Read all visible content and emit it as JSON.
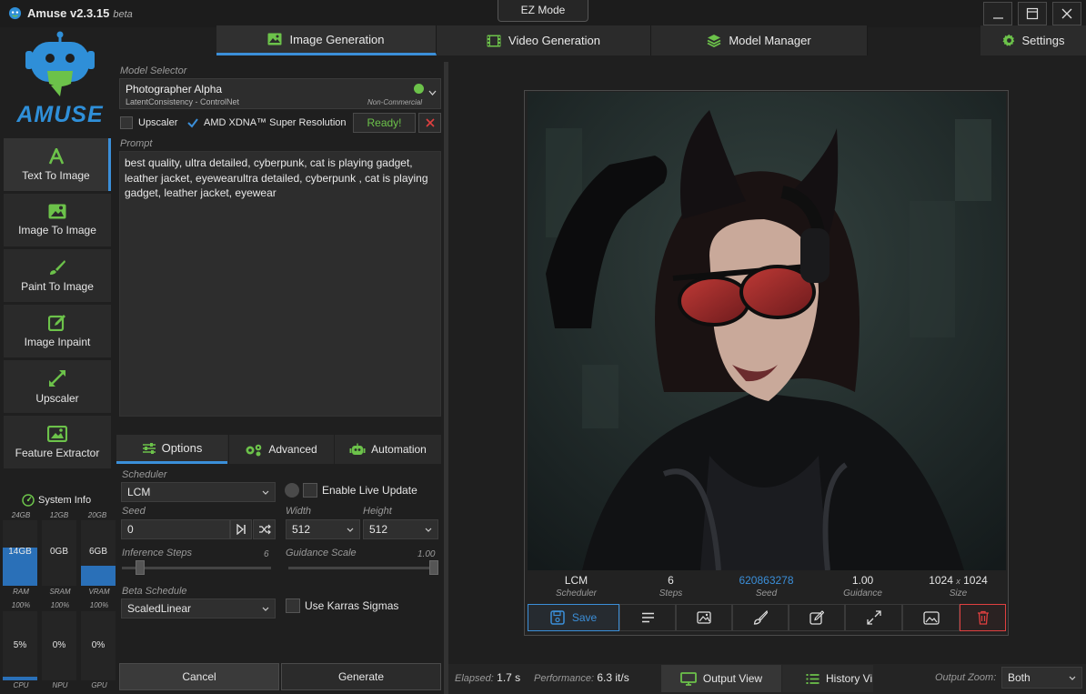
{
  "app": {
    "name": "Amuse v2.3.15",
    "beta": "beta",
    "ez_mode": "EZ Mode",
    "logo_text": "AMUSE"
  },
  "tabs": [
    {
      "label": "Image Generation",
      "icon": "image-icon"
    },
    {
      "label": "Video Generation",
      "icon": "film-icon"
    },
    {
      "label": "Model Manager",
      "icon": "layers-icon"
    }
  ],
  "settings_label": "Settings",
  "sidebar": {
    "items": [
      {
        "label": "Text To Image",
        "icon": "text-icon"
      },
      {
        "label": "Image To Image",
        "icon": "image-icon"
      },
      {
        "label": "Paint To Image",
        "icon": "brush-icon"
      },
      {
        "label": "Image Inpaint",
        "icon": "edit-icon"
      },
      {
        "label": "Upscaler",
        "icon": "expand-icon"
      },
      {
        "label": "Feature Extractor",
        "icon": "image-search-icon"
      }
    ]
  },
  "system_info": {
    "title": "System Info",
    "capacity": [
      "24GB",
      "12GB",
      "20GB"
    ],
    "memory": [
      {
        "value": "14GB",
        "label": "RAM",
        "fill": 0.58
      },
      {
        "value": "0GB",
        "label": "SRAM",
        "fill": 0.0
      },
      {
        "value": "6GB",
        "label": "VRAM",
        "fill": 0.3
      }
    ],
    "max": [
      "100%",
      "100%",
      "100%"
    ],
    "usage": [
      {
        "value": "5%",
        "label": "CPU",
        "fill": 0.05
      },
      {
        "value": "0%",
        "label": "NPU",
        "fill": 0.0
      },
      {
        "value": "0%",
        "label": "GPU",
        "fill": 0.0
      }
    ]
  },
  "model": {
    "section_label": "Model Selector",
    "name": "Photographer Alpha",
    "sub": "LatentConsistency - ControlNet",
    "license": "Non-Commercial",
    "upscaler_label": "Upscaler",
    "xdna_label": "AMD XDNA™ Super Resolution",
    "status": "Ready!",
    "status_color": "#69b34c"
  },
  "prompt": {
    "label": "Prompt",
    "text": "best quality, ultra detailed, cyberpunk, cat is playing gadget, leather jacket, eyewearultra detailed, cyberpunk , cat is playing gadget, leather jacket, eyewear"
  },
  "option_tabs": [
    {
      "label": "Options",
      "icon": "sliders-icon"
    },
    {
      "label": "Advanced",
      "icon": "gears-icon"
    },
    {
      "label": "Automation",
      "icon": "robot-icon"
    }
  ],
  "options": {
    "scheduler_label": "Scheduler",
    "scheduler": "LCM",
    "live_update_label": "Enable Live Update",
    "seed_label": "Seed",
    "seed": "0",
    "width_label": "Width",
    "width": "512",
    "height_label": "Height",
    "height": "512",
    "steps_label": "Inference Steps",
    "steps": "6",
    "steps_fill": 0.1,
    "guidance_label": "Guidance Scale",
    "guidance": "1.00",
    "guidance_fill": 1.0,
    "beta_label": "Beta Schedule",
    "beta": "ScaledLinear",
    "karras_label": "Use Karras Sigmas"
  },
  "actions": {
    "cancel": "Cancel",
    "generate": "Generate"
  },
  "result": {
    "scheduler": "LCM",
    "scheduler_label": "Scheduler",
    "steps": "6",
    "steps_label": "Steps",
    "seed": "620863278",
    "seed_label": "Seed",
    "guidance": "1.00",
    "guidance_label": "Guidance",
    "size_w": "1024",
    "size_x": "x",
    "size_h": "1024",
    "size_label": "Size",
    "save_label": "Save"
  },
  "status_bar": {
    "elapsed_label": "Elapsed:",
    "elapsed": "1.7 s",
    "performance_label": "Performance:",
    "performance": "6.3 it/s",
    "output_view": "Output View",
    "history_view": "History Vi",
    "zoom_label": "Output Zoom:",
    "zoom": "Both"
  },
  "colors": {
    "accent": "#3b8fd9",
    "delete": "#e04040",
    "logo_blue": "#2f8fd8",
    "logo_green": "#6cc24a"
  }
}
